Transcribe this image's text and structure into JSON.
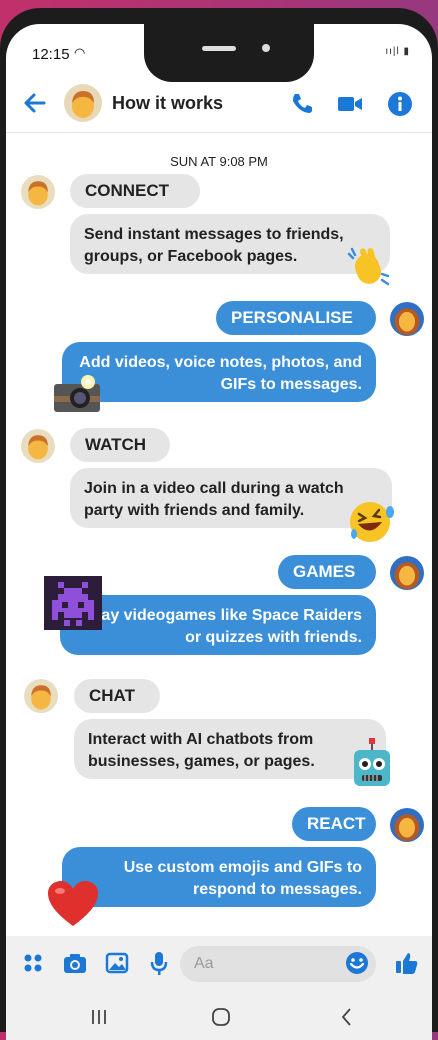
{
  "status": {
    "time": "12:15",
    "right": "ıı|l ▮"
  },
  "header": {
    "title": "How it works"
  },
  "timestamp": "SUN AT 9:08 PM",
  "messages": [
    {
      "label": "CONNECT",
      "text": "Send instant messages to friends, groups, or Facebook pages.",
      "emoji": "waving-hand"
    },
    {
      "label": "PERSONALISE",
      "text": "Add videos, voice notes, photos, and GIFs to messages.",
      "emoji": "camera-with-flash"
    },
    {
      "label": "WATCH",
      "text": "Join in a video call during a watch party with friends and family.",
      "emoji": "laughing-face"
    },
    {
      "label": "GAMES",
      "text": "Play videogames like Space Raiders or quizzes with friends.",
      "emoji": "space-invader"
    },
    {
      "label": "CHAT",
      "text": "Interact with AI chatbots from businesses, games, or pages.",
      "emoji": "robot"
    },
    {
      "label": "REACT",
      "text": "Use custom emojis and GIFs to respond to messages.",
      "emoji": "heart"
    }
  ],
  "composer": {
    "placeholder": "Aa"
  },
  "colors": {
    "accent": "#3b8ed8",
    "incoming_bubble": "#e5e5e5"
  }
}
